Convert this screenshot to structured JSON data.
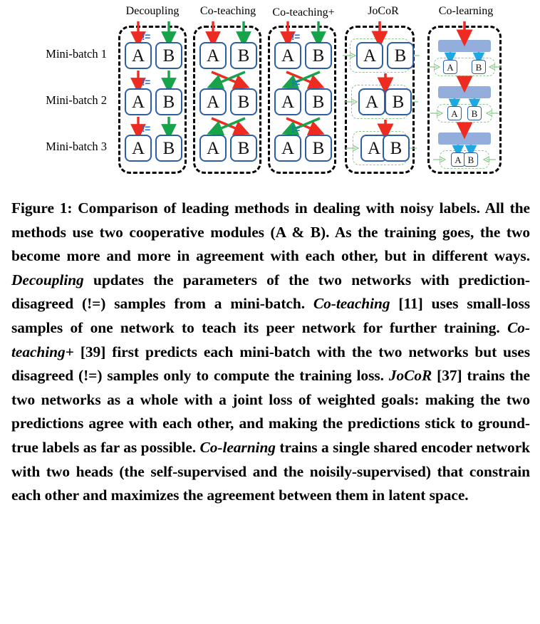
{
  "figure": {
    "columns": [
      {
        "id": "decoupling",
        "label": "Decoupling"
      },
      {
        "id": "co-teaching",
        "label": "Co-teaching"
      },
      {
        "id": "co-teaching-plus",
        "label": "Co-teaching+"
      },
      {
        "id": "jocor",
        "label": "JoCoR"
      },
      {
        "id": "co-learning",
        "label": "Co-learning"
      }
    ],
    "row_labels": [
      "Mini-batch 1",
      "Mini-batch 2",
      "Mini-batch 3"
    ],
    "module_labels": {
      "a": "A",
      "b": "B"
    },
    "disagreement_marker": "!=",
    "colors": {
      "module_border": "#2E5FA3",
      "panel_border": "#000000",
      "arrow_red": "#EE2B20",
      "arrow_green": "#16A34A",
      "arrow_cyan": "#1FA8E0",
      "group_dash_green": "#8FCB8F",
      "encoder_bar": "#93AEDC",
      "neq_blue": "#1B6FD0"
    }
  },
  "caption": {
    "prefix": "Figure 1:",
    "segments": [
      {
        "text": "Figure 1: Comparison of leading methods in dealing with noisy labels. All the methods use two cooperative modules (A & B). As the training goes, the two become more and more in agreement with each other, but in different ways. ",
        "style": "regular"
      },
      {
        "text": "Decoupling",
        "style": "italic"
      },
      {
        "text": " updates the parameters of the two networks with prediction-disagreed (!=) samples from a mini-batch. ",
        "style": "regular"
      },
      {
        "text": "Co-teaching",
        "style": "italic"
      },
      {
        "text": " [11] uses small-loss samples of one network to teach its peer network for further training. ",
        "style": "regular"
      },
      {
        "text": "Co-teaching+",
        "style": "italic"
      },
      {
        "text": " [39] first predicts each mini-batch with the two networks but uses disagreed (!=) samples only to compute the training loss. ",
        "style": "regular"
      },
      {
        "text": "JoCoR",
        "style": "italic"
      },
      {
        "text": " [37] trains the two networks as a whole with a joint loss of weighted goals: making the two predictions agree with each other, and making the predictions stick to ground-true labels as far as possible. ",
        "style": "regular"
      },
      {
        "text": "Co-learning",
        "style": "italic"
      },
      {
        "text": " trains a single shared encoder network with two heads (the self-supervised and the noisily-supervised) that constrain each other and maximizes the agreement between them in latent space.",
        "style": "regular"
      }
    ],
    "citations": [
      "[11]",
      "[39]",
      "[37]"
    ],
    "full_text": "Figure 1: Comparison of leading methods in dealing with noisy labels. All the methods use two cooperative modules (A & B). As the training goes, the two become more and more in agreement with each other, but in different ways. Decoupling updates the parameters of the two networks with prediction-disagreed (!=) samples from a mini-batch. Co-teaching [11] uses small-loss samples of one network to teach its peer network for further training. Co-teaching+ [39] first predicts each mini-batch with the two networks but uses disagreed (!=) samples only to compute the training loss. JoCoR [37] trains the two networks as a whole with a joint loss of weighted goals: making the two predictions agree with each other, and making the predictions stick to ground-true labels as far as possible. Co-learning trains a single shared encoder network with two heads (the self-supervised and the noisily-supervised) that constrain each other and maximizes the agreement between them in latent space."
  }
}
